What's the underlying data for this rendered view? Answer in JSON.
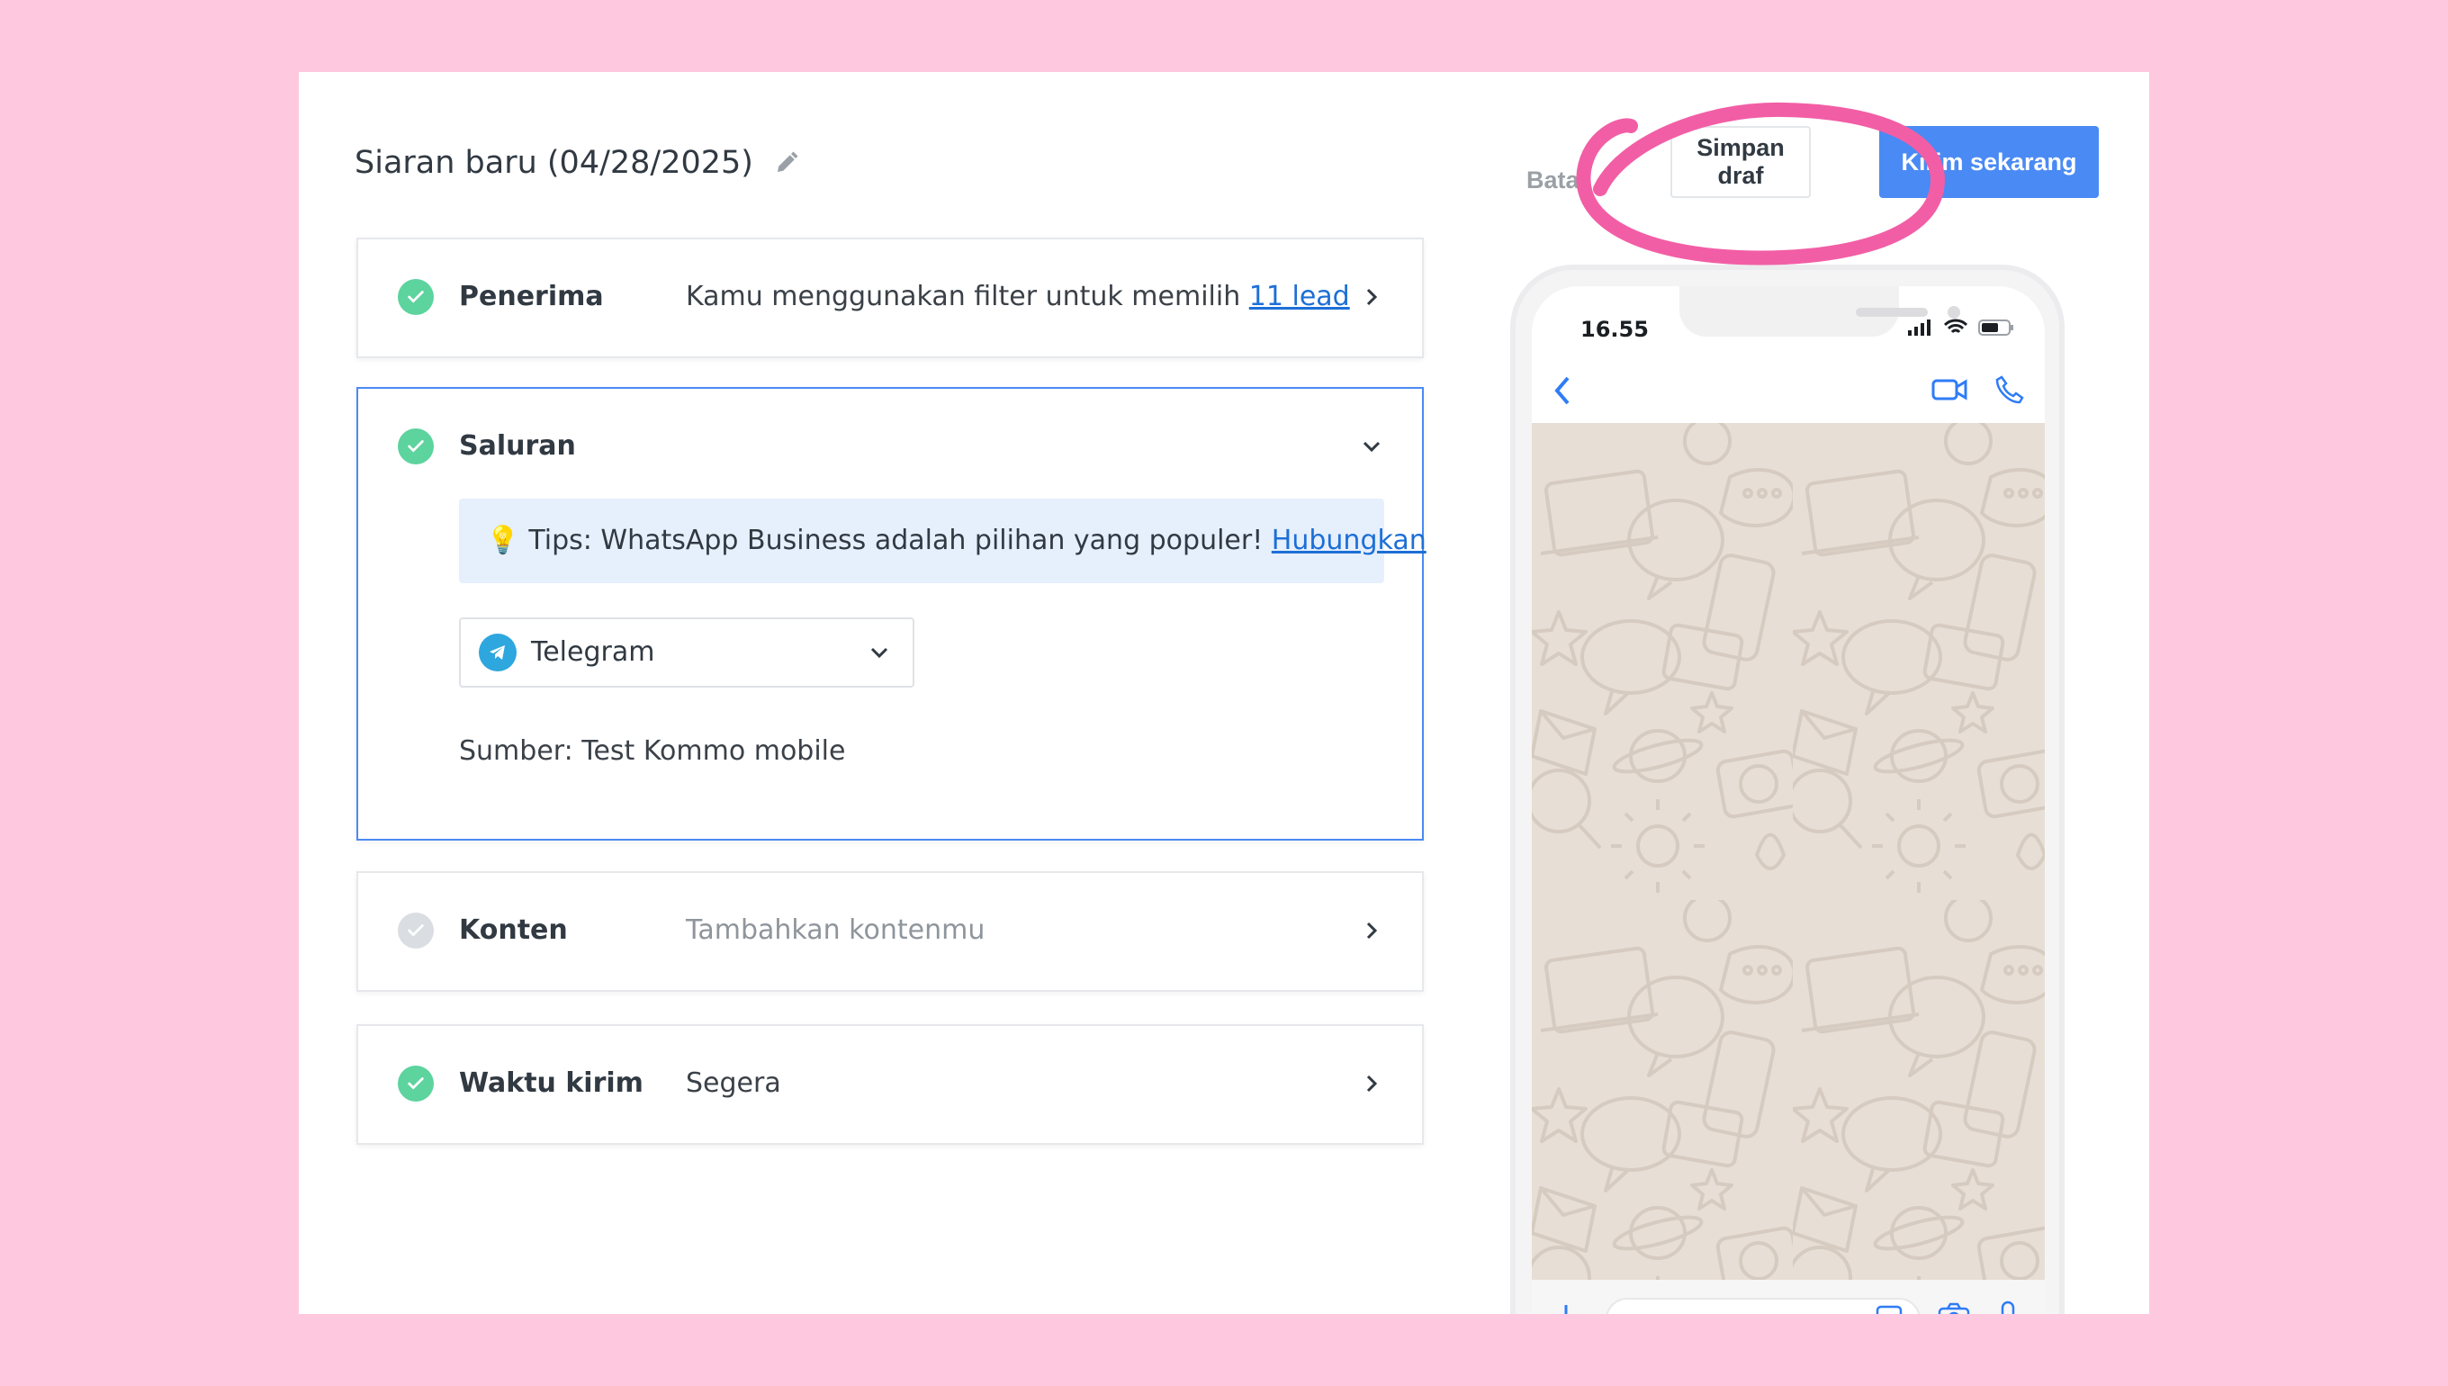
{
  "header": {
    "title": "Siaran baru (04/28/2025)",
    "cancel_label": "Batal",
    "draft_label": "Simpan draf",
    "send_label": "Kirim sekarang"
  },
  "cards": {
    "recipients": {
      "label": "Penerima",
      "text": "Kamu menggunakan filter untuk memilih ",
      "link": "11 lead",
      "status": "complete"
    },
    "channel": {
      "label": "Saluran",
      "tip_text": "Tips: WhatsApp Business adalah pilihan yang populer! ",
      "tip_link": "Hubungkan",
      "selected_channel": "Telegram",
      "source": "Sumber: Test Kommo mobile",
      "status": "complete"
    },
    "content": {
      "label": "Konten",
      "placeholder": "Tambahkan kontenmu",
      "status": "pending"
    },
    "send_time": {
      "label": "Waktu kirim",
      "value": "Segera",
      "status": "complete"
    }
  },
  "phone_preview": {
    "time": "16.55"
  },
  "colors": {
    "background": "#fec8de",
    "accent": "#4a8af4",
    "success": "#5dd39e",
    "annotation": "#f25ea5"
  },
  "icons": [
    "pencil-icon",
    "check-icon",
    "chevron-right-icon",
    "chevron-down-icon",
    "lightbulb-icon",
    "telegram-icon",
    "back-icon",
    "video-icon",
    "phone-icon",
    "plus-icon",
    "sticker-icon",
    "camera-icon",
    "mic-icon"
  ]
}
